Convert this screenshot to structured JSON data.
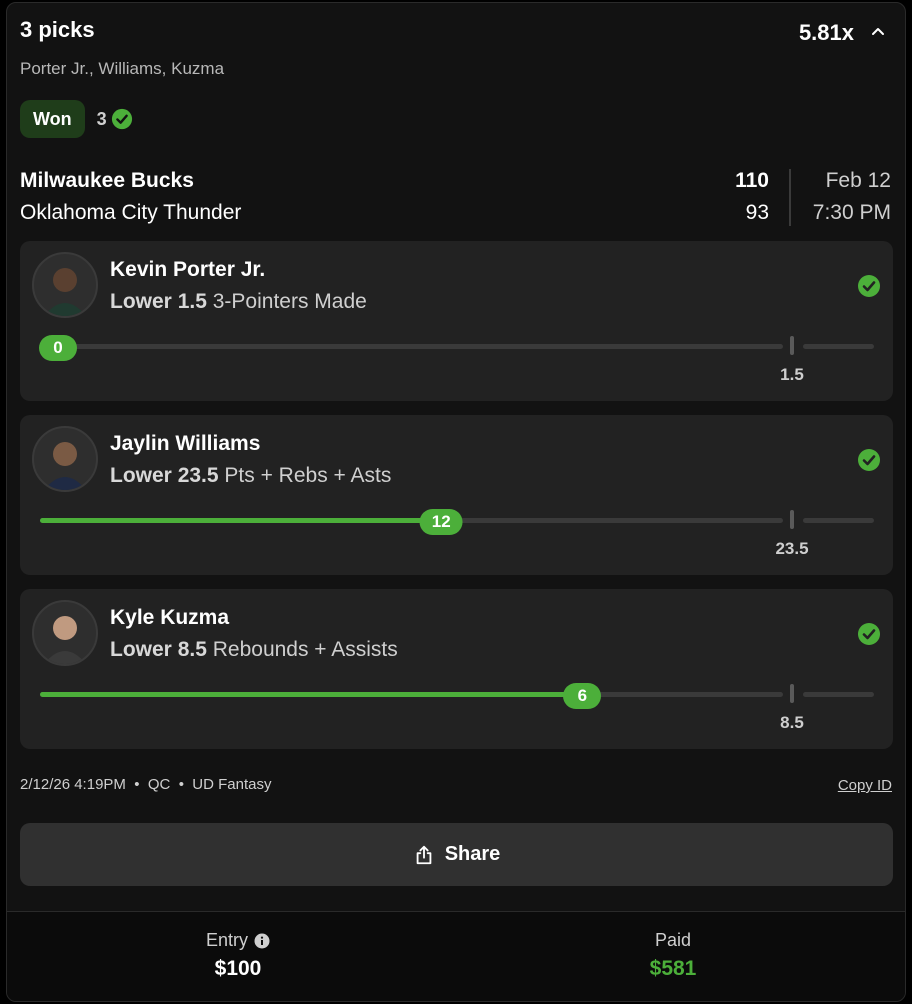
{
  "header": {
    "title": "3 picks",
    "multiplier": "5.81x",
    "players_summary": "Porter Jr., Williams, Kuzma",
    "status_badge": "Won",
    "wins_count": "3"
  },
  "game": {
    "team1": "Milwaukee Bucks",
    "team2": "Oklahoma City Thunder",
    "score1": "110",
    "score2": "93",
    "date": "Feb 12",
    "time": "7:30 PM"
  },
  "picks": [
    {
      "player": "Kevin Porter Jr.",
      "direction": "Lower",
      "line": "1.5",
      "stat": "3-Pointers Made",
      "actual": "0",
      "progress": 0.0,
      "line_label": "1.5",
      "result": "win"
    },
    {
      "player": "Jaylin Williams",
      "direction": "Lower",
      "line": "23.5",
      "stat": "Pts + Rebs + Asts",
      "actual": "12",
      "progress": 0.54,
      "line_label": "23.5",
      "result": "win"
    },
    {
      "player": "Kyle Kuzma",
      "direction": "Lower",
      "line": "8.5",
      "stat": "Rebounds + Assists",
      "actual": "6",
      "progress": 0.73,
      "line_label": "8.5",
      "result": "win"
    }
  ],
  "meta": {
    "timestamp": "2/12/26 4:19PM",
    "region": "QC",
    "platform": "UD Fantasy",
    "copy_id": "Copy ID"
  },
  "share_label": "Share",
  "entry": {
    "label": "Entry",
    "value": "$100"
  },
  "paid": {
    "label": "Paid",
    "value": "$581"
  },
  "colors": {
    "accent": "#4caf3a",
    "badge_bg": "#1f3d1a",
    "card_bg": "#222222",
    "background": "#121212"
  },
  "icons": {
    "chevron": "chevron-up-icon",
    "check": "check-circle-icon",
    "share": "share-icon",
    "info": "info-icon"
  }
}
